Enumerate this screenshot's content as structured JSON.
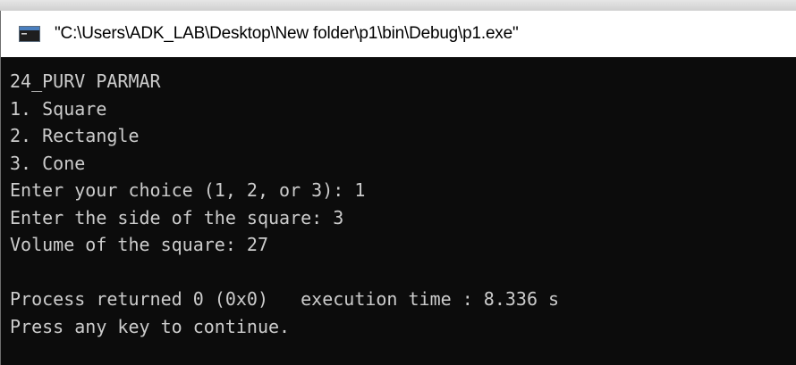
{
  "window": {
    "title": "\"C:\\Users\\ADK_LAB\\Desktop\\New folder\\p1\\bin\\Debug\\p1.exe\"",
    "icon": "console-app-icon"
  },
  "console": {
    "lines": [
      "24_PURV PARMAR",
      "1. Square",
      "2. Rectangle",
      "3. Cone",
      "Enter your choice (1, 2, or 3): 1",
      "Enter the side of the square: 3",
      "Volume of the square: 27",
      "",
      "Process returned 0 (0x0)   execution time : 8.336 s",
      "Press any key to continue."
    ]
  },
  "colors": {
    "console_bg": "#0c0c0c",
    "console_text": "#cccccc",
    "titlebar_bg": "#ffffff"
  }
}
